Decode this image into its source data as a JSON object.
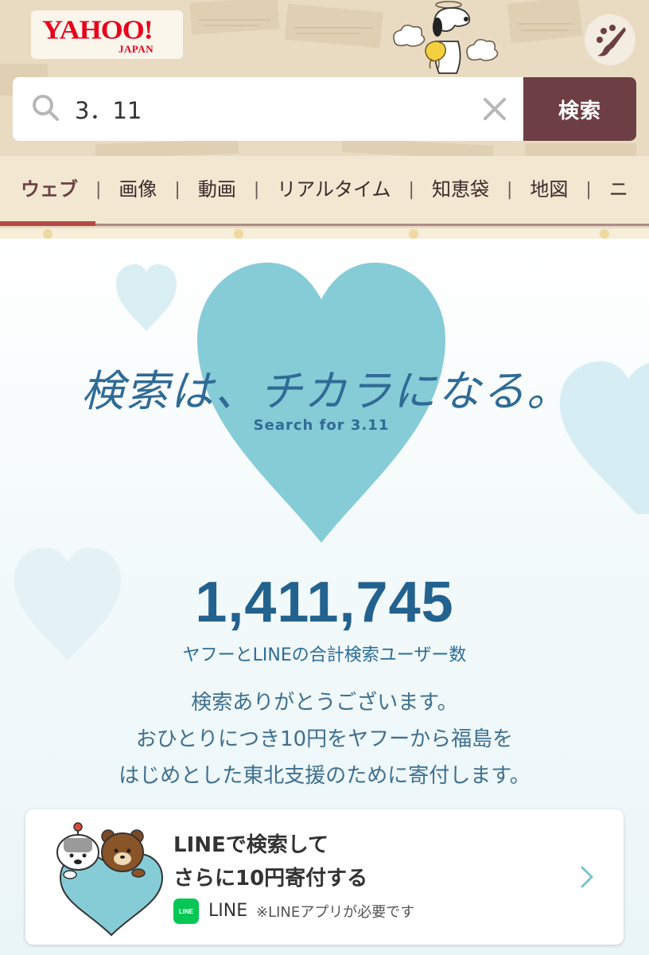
{
  "header": {
    "logo": {
      "main": "YAHOO!",
      "sub": "JAPAN"
    },
    "search": {
      "query": "3．11",
      "button_label": "検索"
    },
    "tabs": [
      {
        "label": "ウェブ",
        "active": true
      },
      {
        "label": "画像"
      },
      {
        "label": "動画"
      },
      {
        "label": "リアルタイム"
      },
      {
        "label": "知恵袋"
      },
      {
        "label": "地図"
      },
      {
        "label": "ニ"
      }
    ]
  },
  "campaign": {
    "headline": "検索は、チカラになる。",
    "subline": "Search for 3.11",
    "counter": "1,411,745",
    "counter_label": "ヤフーとLINEの合計検索ユーザー数",
    "message": [
      "検索ありがとうございます。",
      "おひとりにつき10円をヤフーから福島を",
      "はじめとした東北支援のために寄付します。"
    ]
  },
  "line_card": {
    "title_line1": "LINEで検索して",
    "title_line2": "さらに10円寄付する",
    "badge": "LINE",
    "app_name": "LINE",
    "note": "※LINEアプリが必要です"
  },
  "colors": {
    "brand_red": "#e7001b",
    "search_button": "#6d3f44",
    "heart": "#86ccd7",
    "counter": "#23628e",
    "line_green": "#06c755"
  }
}
